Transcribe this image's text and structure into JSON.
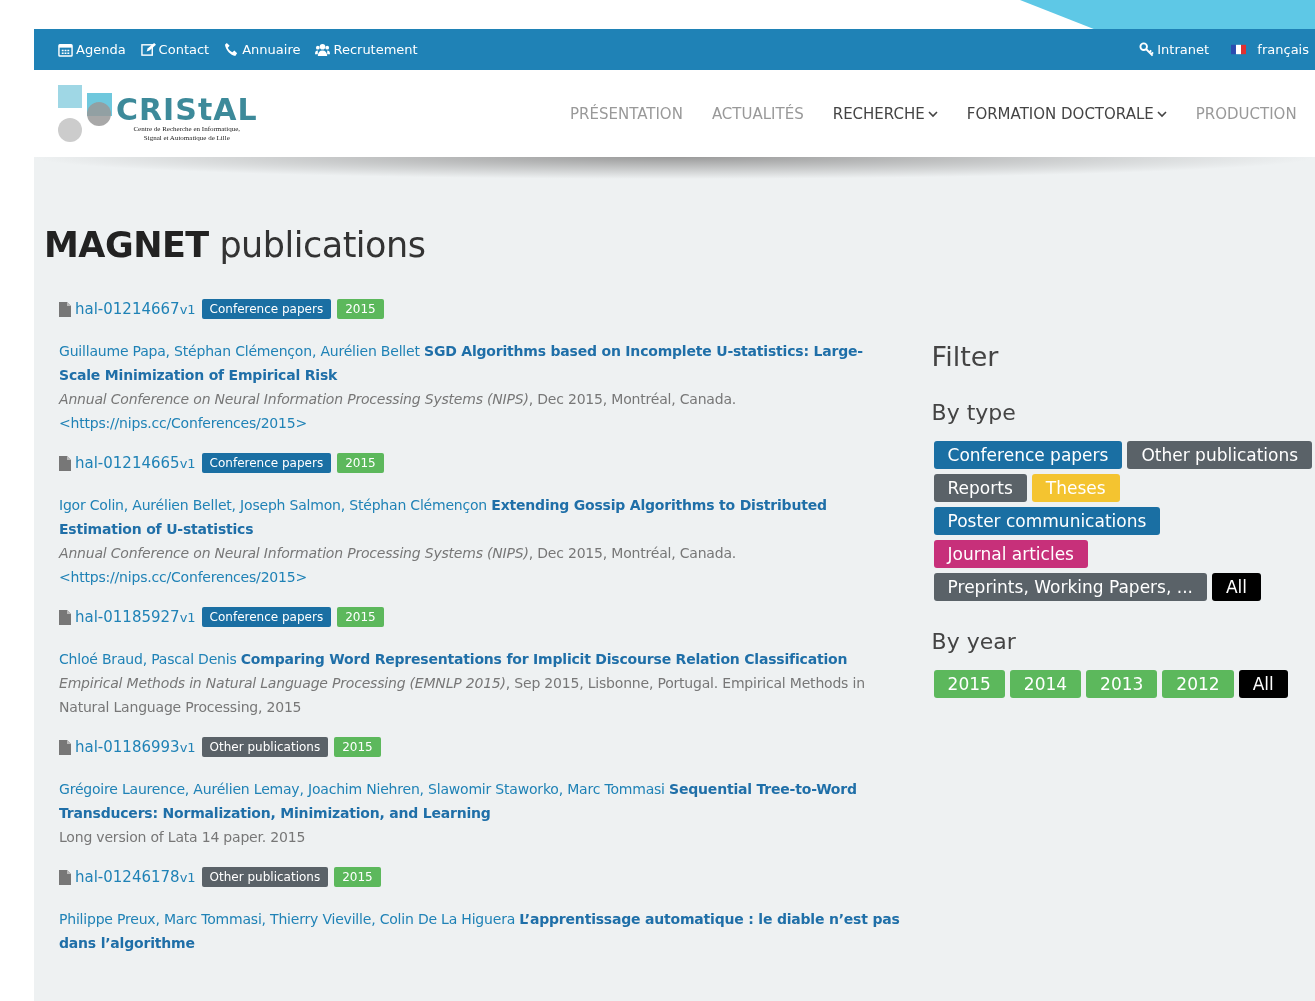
{
  "top_bar": {
    "left_links": [
      {
        "kind": "calendar",
        "label": "Agenda"
      },
      {
        "kind": "edit",
        "label": "Contact"
      },
      {
        "kind": "phone",
        "label": "Annuaire"
      },
      {
        "kind": "users",
        "label": "Recrutement"
      }
    ],
    "right_links": [
      {
        "kind": "key",
        "label": "Intranet"
      },
      {
        "kind": "flag",
        "label": "français"
      }
    ]
  },
  "header": {
    "logo": {
      "name": "CRIStAL",
      "subtitle_lines": [
        "Centre de Recherche en Informatique,",
        "Signal et Automatique de Lille"
      ]
    },
    "nav": [
      {
        "label": "PRÉSENTATION",
        "has_dropdown": false
      },
      {
        "label": "ACTUALITÉS",
        "has_dropdown": false
      },
      {
        "label": "RECHERCHE",
        "has_dropdown": true
      },
      {
        "label": "FORMATION DOCTORALE",
        "has_dropdown": true
      },
      {
        "label": "PRODUCTION",
        "has_dropdown": false
      }
    ]
  },
  "page_title": {
    "bold": "MAGNET",
    "rest": "publications"
  },
  "publications": [
    {
      "hal_id": "hal-01214667",
      "version": "v1",
      "type_tag": {
        "label": "Conference papers",
        "color": "#1a6fa3"
      },
      "year_tag": {
        "label": "2015",
        "color": "#5cb85c"
      },
      "authors": "Guillaume Papa, Stéphan Clémençon, Aurélien Bellet",
      "title": "SGD Algorithms based on Incomplete U-statistics: Large-Scale Minimization of Empirical Risk",
      "venue": "Annual Conference on Neural Information Processing Systems (NIPS)",
      "details": ", Dec 2015, Montréal, Canada. ",
      "link": "<https://nips.cc/Conferences/2015>"
    },
    {
      "hal_id": "hal-01214665",
      "version": "v1",
      "type_tag": {
        "label": "Conference papers",
        "color": "#1a6fa3"
      },
      "year_tag": {
        "label": "2015",
        "color": "#5cb85c"
      },
      "authors": "Igor Colin, Aurélien Bellet, Joseph Salmon, Stéphan Clémençon",
      "title": "Extending Gossip Algorithms to Distributed Estimation of U-statistics",
      "venue": "Annual Conference on Neural Information Processing Systems (NIPS)",
      "details": ", Dec 2015, Montréal, Canada. ",
      "link": "<https://nips.cc/Conferences/2015>"
    },
    {
      "hal_id": "hal-01185927",
      "version": "v1",
      "type_tag": {
        "label": "Conference papers",
        "color": "#1a6fa3"
      },
      "year_tag": {
        "label": "2015",
        "color": "#5cb85c"
      },
      "authors": "Chloé Braud, Pascal Denis",
      "title": "Comparing Word Representations for Implicit Discourse Relation Classification",
      "venue": "Empirical Methods in Natural Language Processing (EMNLP 2015)",
      "details": ", Sep 2015, Lisbonne, Portugal. Empirical Methods in Natural Language Processing, 2015"
    },
    {
      "hal_id": "hal-01186993",
      "version": "v1",
      "type_tag": {
        "label": "Other publications",
        "color": "#5a6268"
      },
      "year_tag": {
        "label": "2015",
        "color": "#5cb85c"
      },
      "authors": "Grégoire Laurence, Aurélien Lemay, Joachim Niehren, Slawomir Staworko, Marc Tommasi",
      "title": "Sequential Tree-to-Word Transducers: Normalization, Minimization, and Learning",
      "details": "Long version of Lata 14 paper. 2015"
    },
    {
      "hal_id": "hal-01246178",
      "version": "v1",
      "type_tag": {
        "label": "Other publications",
        "color": "#5a6268"
      },
      "year_tag": {
        "label": "2015",
        "color": "#5cb85c"
      },
      "authors": "Philippe Preux, Marc Tommasi, Thierry Vieville, Colin De La Higuera",
      "title": "L’apprentissage automatique : le diable n’est pas dans l’algorithme"
    }
  ],
  "filter": {
    "title": "Filter",
    "groups": [
      {
        "heading": "By type",
        "tags": [
          {
            "label": "Conference papers",
            "color": "#1a6fa3"
          },
          {
            "label": "Other publications",
            "color": "#5a6268"
          },
          {
            "label": "Reports",
            "color": "#5a6268"
          },
          {
            "label": "Theses",
            "color": "#f4c430"
          },
          {
            "label": "Poster communications",
            "color": "#1a6fa3"
          },
          {
            "label": "Journal articles",
            "color": "#c7307a"
          },
          {
            "label": "Preprints, Working Papers, ...",
            "color": "#5a6268"
          },
          {
            "label": "All",
            "color": "#000000"
          }
        ]
      },
      {
        "heading": "By year",
        "tags": [
          {
            "label": "2015",
            "color": "#5cb85c"
          },
          {
            "label": "2014",
            "color": "#5cb85c"
          },
          {
            "label": "2013",
            "color": "#5cb85c"
          },
          {
            "label": "2012",
            "color": "#5cb85c"
          },
          {
            "label": "All",
            "color": "#000000"
          }
        ]
      }
    ]
  }
}
